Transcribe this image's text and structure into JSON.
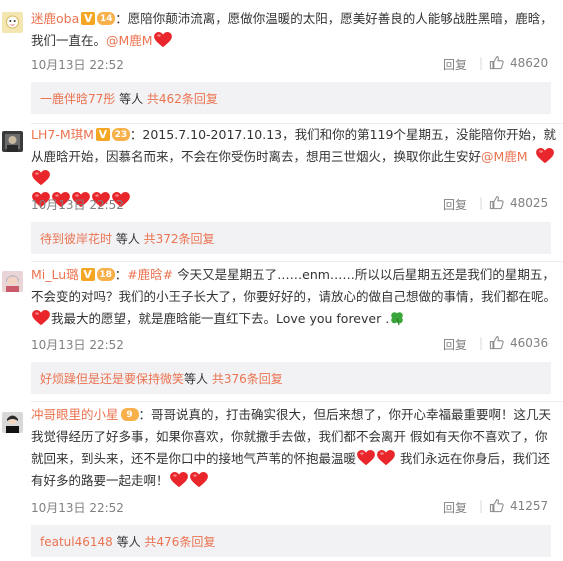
{
  "comments": [
    {
      "username": "迷鹿oba",
      "text_before": "：愿陪你颠沛流离，愿做你温暖的太阳，愿美好善良的人能够战胜黑暗，鹿晗，我们一直在。",
      "mention": "@M鹿M",
      "time": "10月13日 22:52",
      "reply_label": "回复",
      "likes": "48620",
      "sub_user": "一鹿伴晗77彤",
      "sub_mid": " 等人 ",
      "sub_count": "共462条回复"
    },
    {
      "username": "LH7-M琪M",
      "text_before": "：2015.7.10-2017.10.13，我们和你的第119个星期五，没能陪你开始，就从鹿晗开始，因慕名而来，不会在你受伤时离去，想用三世烟火，换取你此生安好",
      "mention": "@M鹿M",
      "time": "10月13日 22:52",
      "reply_label": "回复",
      "likes": "48025",
      "sub_user": "待到彼岸花时",
      "sub_mid": " 等人 ",
      "sub_count": "共372条回复"
    },
    {
      "username": "Mi_Lu璐",
      "topic": "#鹿晗#",
      "text_before": " 今天又是星期五了……enm……所以以后星期五还是我们的星期五，不会变的对吗？我们的小王子长大了，你要好好的，请放心的做自己想做的事情，我们都在呢。",
      "text_after": "我最大的愿望，就是鹿晗能一直红下去。Love you forever .",
      "time": "10月13日 22:52",
      "reply_label": "回复",
      "likes": "46036",
      "sub_user": "好烦躁但是还是要保持微笑",
      "sub_mid": "等人 ",
      "sub_count": "共376条回复"
    },
    {
      "username": "冲哥眼里的小星",
      "text_before": "：哥哥说真的，打击确实很大，但后来想了，你开心幸福最重要啊！这几天我觉得经历了好多事，如果你喜欢，你就撒手去做，我们都不会离开 假如有天你不喜欢了，你就回来，到头来，还不是你口中的接地气芦苇的怀抱最温暖",
      "text_mid": " 我们永远在你身后，我们还有好多的路要一起走啊！",
      "time": "10月13日 22:52",
      "reply_label": "回复",
      "likes": "41257",
      "sub_user": "featul46148",
      "sub_mid": " 等人 ",
      "sub_count": "共476条回复"
    }
  ],
  "colors": {
    "accent": "#eb7350",
    "heart": "#e8262b",
    "meta": "#808080",
    "sub_bg": "#f2f2f5"
  },
  "icons": {
    "like": "thumbs-up-icon",
    "vip": "vip-badge-icon",
    "heart": "red-heart-emoji",
    "clover": "four-leaf-clover-emoji"
  }
}
